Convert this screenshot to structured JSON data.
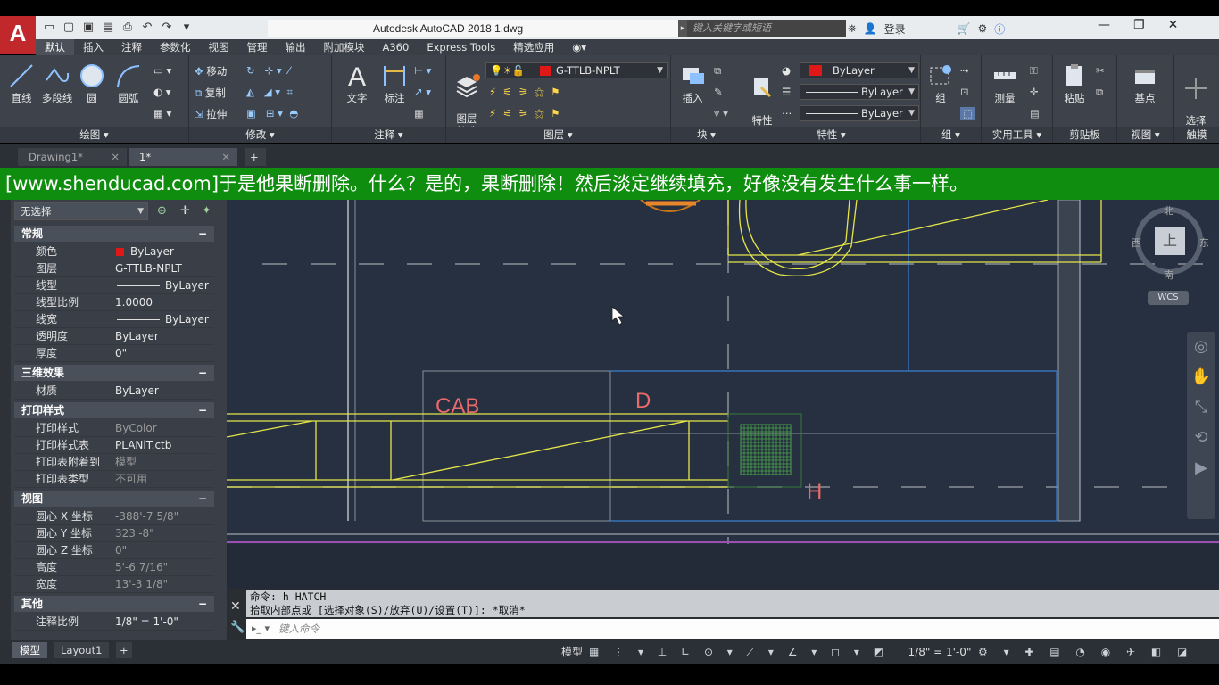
{
  "app": {
    "title": "Autodesk AutoCAD 2018    1.dwg",
    "logo": "A",
    "search_placeholder": "键入关键字或短语",
    "sign_in": "登录"
  },
  "ribbon_tabs": [
    "默认",
    "插入",
    "注释",
    "参数化",
    "视图",
    "管理",
    "输出",
    "附加模块",
    "A360",
    "Express Tools",
    "精选应用"
  ],
  "ribbon": {
    "draw": {
      "title": "绘图",
      "line": "直线",
      "polyline": "多段线",
      "circle": "圆",
      "arc": "圆弧"
    },
    "modify": {
      "title": "修改",
      "move": "移动",
      "copy": "复制",
      "stretch": "拉伸"
    },
    "annotation": {
      "title": "注释",
      "text": "文字",
      "dimension": "标注"
    },
    "layers": {
      "title": "图层",
      "layer_props": "图层\n特性",
      "current_layer": "G-TTLB-NPLT"
    },
    "block": {
      "title": "块",
      "insert": "插入"
    },
    "properties": {
      "title": "特性",
      "match": "特性\n匹配",
      "color": "ByLayer",
      "linetype": "ByLayer",
      "lineweight": "ByLayer"
    },
    "groups": {
      "title": "组",
      "group": "组"
    },
    "utilities": {
      "title": "实用工具",
      "measure": "测量"
    },
    "clipboard": {
      "title": "剪贴板",
      "paste": "粘贴"
    },
    "view": {
      "title": "视图",
      "base": "基点"
    },
    "touch": {
      "title": "触摸",
      "select_mode": "选择\n模式"
    }
  },
  "file_tabs": [
    "Drawing1*",
    "1*"
  ],
  "banner": "[www.shenducad.com]于是他果断删除。什么？是的，果断删除！然后淡定继续填充，好像没有发生什么事一样。",
  "palette": {
    "selection": "无选择",
    "sections": [
      {
        "title": "常规",
        "rows": [
          [
            "颜色",
            "ByLayer"
          ],
          [
            "图层",
            "G-TTLB-NPLT"
          ],
          [
            "线型",
            "ByLayer"
          ],
          [
            "线型比例",
            "1.0000"
          ],
          [
            "线宽",
            "ByLayer"
          ],
          [
            "透明度",
            "ByLayer"
          ],
          [
            "厚度",
            "0\""
          ]
        ]
      },
      {
        "title": "三维效果",
        "rows": [
          [
            "材质",
            "ByLayer"
          ]
        ]
      },
      {
        "title": "打印样式",
        "rows": [
          [
            "打印样式",
            "ByColor"
          ],
          [
            "打印样式表",
            "PLANiT.ctb"
          ],
          [
            "打印表附着到",
            "模型"
          ],
          [
            "打印表类型",
            "不可用"
          ]
        ]
      },
      {
        "title": "视图",
        "rows": [
          [
            "圆心 X 坐标",
            "-388'-7 5/8\""
          ],
          [
            "圆心 Y 坐标",
            "323'-8\""
          ],
          [
            "圆心 Z 坐标",
            "0\""
          ],
          [
            "高度",
            "5'-6 7/16\""
          ],
          [
            "宽度",
            "13'-3 1/8\""
          ]
        ]
      },
      {
        "title": "其他",
        "rows": [
          [
            "注释比例",
            "1/8\" = 1'-0\""
          ]
        ]
      }
    ]
  },
  "drawing": {
    "labels": {
      "cab": "CAB",
      "d": "D",
      "h": "H"
    },
    "viewcube": {
      "north": "北",
      "south": "南",
      "east": "东",
      "west": "西",
      "top": "上",
      "wcs": "WCS"
    }
  },
  "command": {
    "line1": "命令: h HATCH",
    "line2": "拾取内部点或 [选择对象(S)/放弃(U)/设置(T)]: *取消*",
    "placeholder": "键入命令"
  },
  "layout_tabs": [
    "模型",
    "Layout1"
  ],
  "status": {
    "model": "模型",
    "scale": "1/8\" = 1'-0\""
  },
  "colors": {
    "banner": "#0f8d0f",
    "yellow_lines": "#e6e64a",
    "blue_lines": "#3a7fd0",
    "label_red": "#e86a6a"
  }
}
